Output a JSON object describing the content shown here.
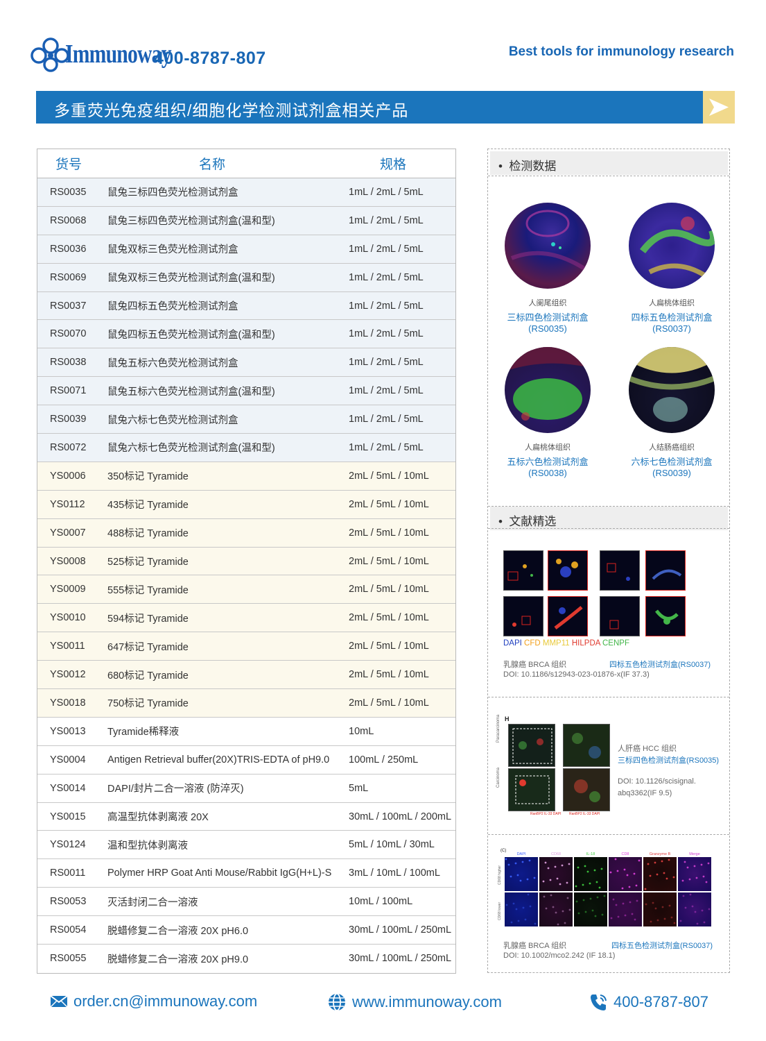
{
  "header": {
    "brand": "Immunoway",
    "phone": "400-8787-807",
    "tagline": "Best tools for immunology research"
  },
  "title": "多重荧光免疫组织/细胞化学检测试剂盒相关产品",
  "table": {
    "columns": [
      "货号",
      "名称",
      "规格"
    ],
    "rows": [
      {
        "code": "RS0035",
        "name": "鼠兔三标四色荧光检测试剂盒",
        "spec": "1mL / 2mL / 5mL",
        "group": "rs"
      },
      {
        "code": "RS0068",
        "name": "鼠兔三标四色荧光检测试剂盒(温和型)",
        "spec": "1mL / 2mL / 5mL",
        "group": "rs"
      },
      {
        "code": "RS0036",
        "name": "鼠兔双标三色荧光检测试剂盒",
        "spec": "1mL / 2mL / 5mL",
        "group": "rs"
      },
      {
        "code": "RS0069",
        "name": "鼠兔双标三色荧光检测试剂盒(温和型)",
        "spec": "1mL / 2mL / 5mL",
        "group": "rs"
      },
      {
        "code": "RS0037",
        "name": "鼠兔四标五色荧光检测试剂盒",
        "spec": "1mL / 2mL / 5mL",
        "group": "rs"
      },
      {
        "code": "RS0070",
        "name": "鼠兔四标五色荧光检测试剂盒(温和型)",
        "spec": "1mL / 2mL / 5mL",
        "group": "rs"
      },
      {
        "code": "RS0038",
        "name": "鼠兔五标六色荧光检测试剂盒",
        "spec": "1mL / 2mL / 5mL",
        "group": "rs"
      },
      {
        "code": "RS0071",
        "name": "鼠兔五标六色荧光检测试剂盒(温和型)",
        "spec": "1mL / 2mL / 5mL",
        "group": "rs"
      },
      {
        "code": "RS0039",
        "name": "鼠兔六标七色荧光检测试剂盒",
        "spec": "1mL / 2mL / 5mL",
        "group": "rs"
      },
      {
        "code": "RS0072",
        "name": "鼠兔六标七色荧光检测试剂盒(温和型)",
        "spec": "1mL / 2mL / 5mL",
        "group": "rs"
      },
      {
        "code": "YS0006",
        "name": "350标记 Tyramide",
        "spec": "2mL / 5mL / 10mL",
        "group": "ys"
      },
      {
        "code": "YS0112",
        "name": "435标记 Tyramide",
        "spec": "2mL / 5mL / 10mL",
        "group": "ys"
      },
      {
        "code": "YS0007",
        "name": "488标记 Tyramide",
        "spec": "2mL / 5mL / 10mL",
        "group": "ys"
      },
      {
        "code": "YS0008",
        "name": "525标记 Tyramide",
        "spec": "2mL / 5mL / 10mL",
        "group": "ys"
      },
      {
        "code": "YS0009",
        "name": "555标记 Tyramide",
        "spec": "2mL / 5mL / 10mL",
        "group": "ys"
      },
      {
        "code": "YS0010",
        "name": "594标记 Tyramide",
        "spec": "2mL / 5mL / 10mL",
        "group": "ys"
      },
      {
        "code": "YS0011",
        "name": "647标记 Tyramide",
        "spec": "2mL / 5mL / 10mL",
        "group": "ys"
      },
      {
        "code": "YS0012",
        "name": "680标记 Tyramide",
        "spec": "2mL / 5mL / 10mL",
        "group": "ys"
      },
      {
        "code": "YS0018",
        "name": "750标记 Tyramide",
        "spec": "2mL / 5mL / 10mL",
        "group": "ys"
      },
      {
        "code": "YS0013",
        "name": "Tyramide稀释液",
        "spec": "10mL",
        "group": "plain"
      },
      {
        "code": "YS0004",
        "name": "Antigen Retrieval buffer(20X)TRIS-EDTA of pH9.0",
        "spec": "100mL / 250mL",
        "group": "plain"
      },
      {
        "code": "YS0014",
        "name": "DAPI/封片二合一溶液 (防淬灭)",
        "spec": "5mL",
        "group": "plain"
      },
      {
        "code": "YS0015",
        "name": "高温型抗体剥离液 20X",
        "spec": "30mL / 100mL / 200mL",
        "group": "plain"
      },
      {
        "code": "YS0124",
        "name": "温和型抗体剥离液",
        "spec": "5mL / 10mL / 30mL",
        "group": "plain"
      },
      {
        "code": "RS0011",
        "name": "Polymer HRP Goat Anti Mouse/Rabbit IgG(H+L)-S",
        "spec": "3mL / 10mL / 100mL",
        "group": "plain"
      },
      {
        "code": "RS0053",
        "name": "灭活封闭二合一溶液",
        "spec": "10mL / 100mL",
        "group": "plain"
      },
      {
        "code": "RS0054",
        "name": "脱蜡修复二合一溶液 20X pH6.0",
        "spec": "30mL / 100mL / 250mL",
        "group": "plain"
      },
      {
        "code": "RS0055",
        "name": "脱蜡修复二合一溶液 20X pH9.0",
        "spec": "30mL / 100mL / 250mL",
        "group": "plain"
      }
    ]
  },
  "panel": {
    "detection": {
      "heading": "检测数据",
      "items": [
        {
          "tissue": "人阑尾组织",
          "kit": "三标四色检测试剂盒",
          "code": "(RS0035)"
        },
        {
          "tissue": "人扁桃体组织",
          "kit": "四标五色检测试剂盒",
          "code": "(RS0037)"
        },
        {
          "tissue": "人扁桃体组织",
          "kit": "五标六色检测试剂盒",
          "code": "(RS0038)"
        },
        {
          "tissue": "人结肠癌组织",
          "kit": "六标七色检测试剂盒",
          "code": "(RS0039)"
        }
      ]
    },
    "literature": {
      "heading": "文献精选",
      "legend": [
        {
          "text": "DAPI",
          "color": "#1f3fbf"
        },
        {
          "text": "CFD",
          "color": "#f2a01c"
        },
        {
          "text": "MMP11",
          "color": "#e8c93a"
        },
        {
          "text": "HILPDA",
          "color": "#e03a2f"
        },
        {
          "text": "CENPF",
          "color": "#43b649"
        }
      ],
      "ref1": {
        "tissue": "乳腺癌 BRCA 组织",
        "kit": "四标五色检测试剂盒(RS0037)",
        "doi": "DOI: 10.1186/s12943-023-01876-x(IF 37.3)"
      },
      "ref2": {
        "panel_label": "H",
        "tissue": "人肝癌 HCC 组织",
        "kit": "三标四色检测试剂盒(RS0035)",
        "doi1": "DOI: 10.1126/scisignal.",
        "doi2": "abq3362(IF 9.5)",
        "row_labels": [
          "Paracarcinoma",
          "Carcinoma"
        ],
        "legend": [
          "RanBP2 IL-33 DAPI",
          "RanBP2 IL-33 DAPI"
        ]
      },
      "ref3": {
        "panel_label": "(C)",
        "columns": [
          "DAPI",
          "CD68",
          "IL-18",
          "CD8",
          "Granzyme B",
          "Merge"
        ],
        "rows": [
          "CD68 higher",
          "CD68 lower"
        ],
        "tissue": "乳腺癌 BRCA 组织",
        "kit": "四标五色检测试剂盒(RS0037)",
        "doi": "DOI: 10.1002/mco2.242 (IF 18.1)"
      }
    }
  },
  "footer": {
    "email": "order.cn@immunoway.com",
    "website": "www.immunoway.com",
    "phone": "400-8787-807"
  },
  "colors": {
    "brand_blue": "#1b75bc",
    "arrow_yellow": "#f1d98c",
    "rs_row_bg": "#eef3f8",
    "ys_row_bg": "#fcf9ec"
  },
  "icons": [
    "logo-rings-icon",
    "play-arrow-icon",
    "mail-icon",
    "globe-icon",
    "phone-icon"
  ]
}
